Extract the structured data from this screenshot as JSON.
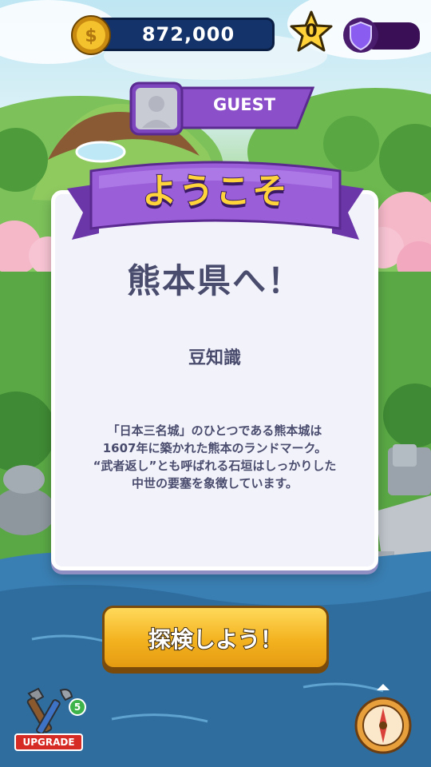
{
  "header": {
    "coins": "872,000",
    "stars": "0"
  },
  "profile": {
    "name": "GUEST"
  },
  "card": {
    "banner": "ようこそ",
    "headline": "熊本県へ！",
    "subhead": "豆知識",
    "body_lines": [
      "「日本三名城」のひとつである熊本城は",
      "1607年に築かれた熊本のランドマーク。",
      "“武者返し”とも呼ばれる石垣はしっかりした",
      "中世の要塞を象徴しています。"
    ]
  },
  "actions": {
    "explore_label": "探検しよう！",
    "upgrade_label": "UPGRADE",
    "upgrade_count": "5"
  },
  "icons": [
    "coin-icon",
    "star-icon",
    "shield-icon",
    "avatar-icon",
    "tools-icon",
    "compass-icon"
  ],
  "colors": {
    "panel_text": "#4a4c6e",
    "banner_purple": "#8a4fc9",
    "button_gold": "#f3b21f",
    "coin_bar": "#13336a"
  }
}
